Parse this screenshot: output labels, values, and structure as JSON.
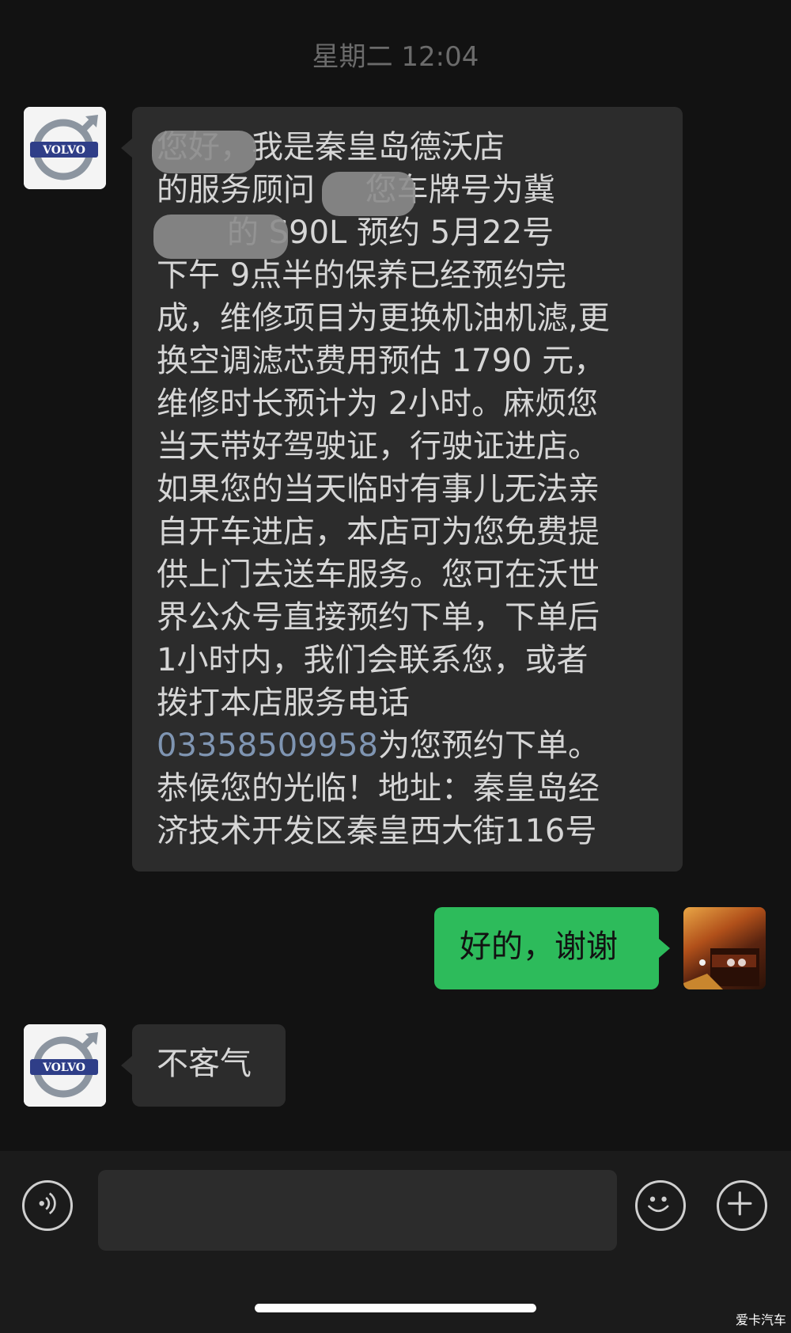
{
  "timestamp": "星期二 12:04",
  "contact": {
    "avatar_logo_text": "VOLVO"
  },
  "messages": [
    {
      "direction": "incoming",
      "text_main": "您好，我是秦皇岛德沃店\n的服务顾问     您车牌号为冀\n       的 S90L 预约 5月22号\n下午 9点半的保养已经预约完\n成，维修项目为更换机油机滤,更\n换空调滤芯费用预估 1790 元，\n维修时长预计为 2小时。麻烦您\n当天带好驾驶证，行驶证进店。\n如果您的当天临时有事儿无法亲\n自开车进店，本店可为您免费提\n供上门去送车服务。您可在沃世\n界公众号直接预约下单，下单后\n1小时内，我们会联系您，或者\n拨打本店服务电话\n",
      "phone": "03358509958",
      "text_after_phone": "为您预约下单。\n恭候您的光临！地址：秦皇岛经\n济技术开发区秦皇西大街116号"
    },
    {
      "direction": "outgoing",
      "text": "好的，谢谢"
    },
    {
      "direction": "incoming",
      "text": "不客气"
    }
  ],
  "input_bar": {
    "voice_icon": "voice-icon",
    "emoji_icon": "emoji-icon",
    "plus_icon": "plus-icon"
  },
  "watermark": "爱卡汽车"
}
